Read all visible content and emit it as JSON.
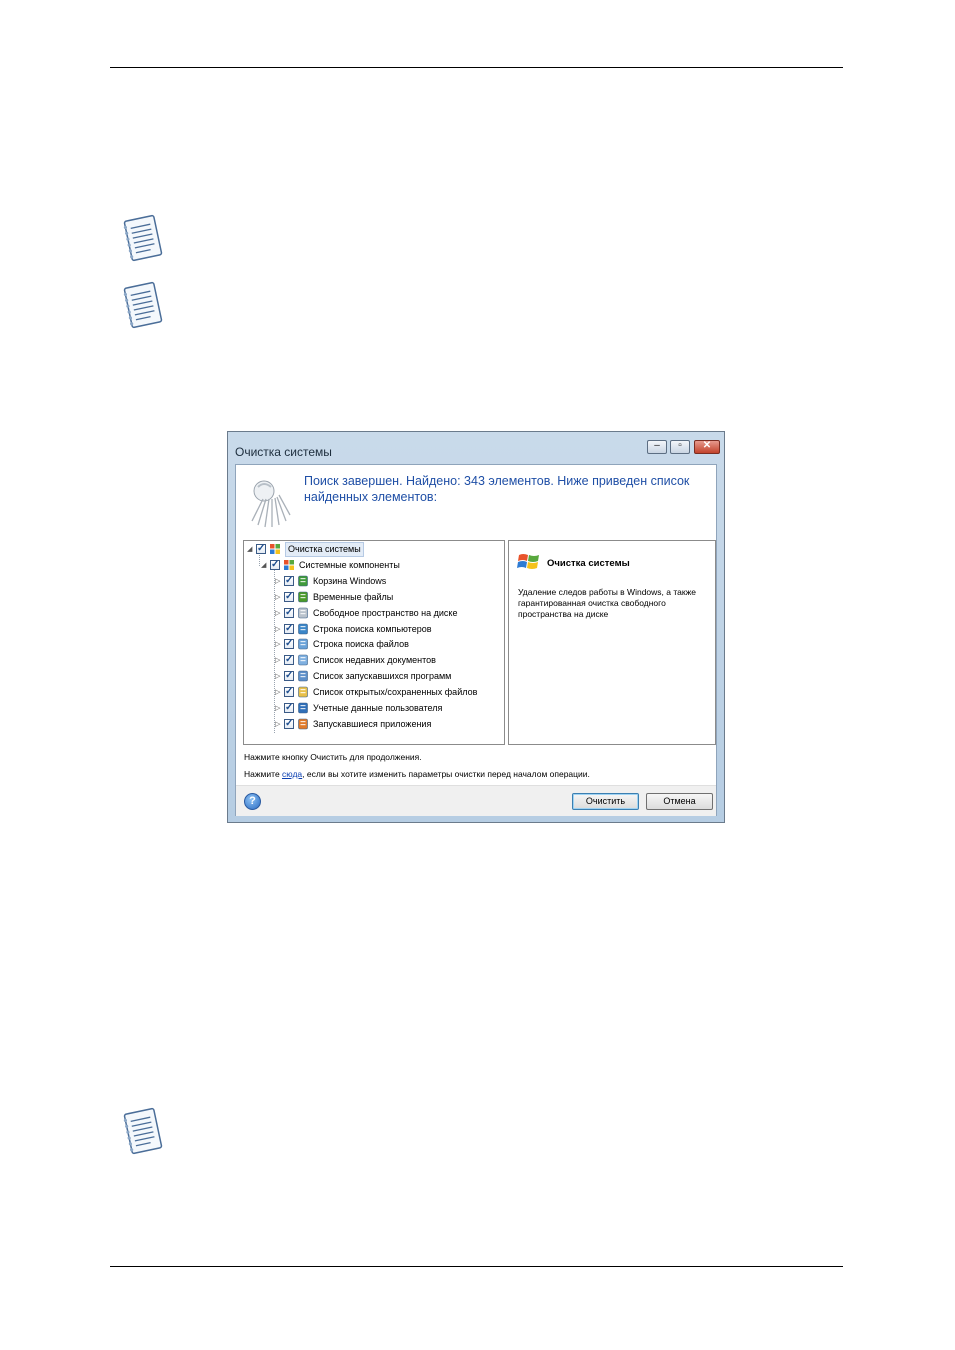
{
  "dialog": {
    "title": "Очистка системы",
    "header_message": "Поиск завершен. Найдено: 343 элементов. Ниже приведен список найденных элементов:",
    "tree": [
      {
        "label": "Очистка системы",
        "level": 0,
        "icon": "windows-flag-icon",
        "selected": true
      },
      {
        "label": "Системные компоненты",
        "level": 1,
        "icon": "windows-flag-icon"
      },
      {
        "label": "Корзина Windows",
        "level": 2,
        "icon": "recycle-bin-icon"
      },
      {
        "label": "Временные файлы",
        "level": 2,
        "icon": "temp-files-icon"
      },
      {
        "label": "Свободное пространство на диске",
        "level": 2,
        "icon": "disk-icon"
      },
      {
        "label": "Строка поиска компьютеров",
        "level": 2,
        "icon": "network-search-icon"
      },
      {
        "label": "Строка поиска файлов",
        "level": 2,
        "icon": "file-search-icon"
      },
      {
        "label": "Список недавних документов",
        "level": 2,
        "icon": "recent-docs-icon"
      },
      {
        "label": "Список запускавшихся программ",
        "level": 2,
        "icon": "run-list-icon"
      },
      {
        "label": "Список открытых/сохраненных файлов",
        "level": 2,
        "icon": "folder-icon"
      },
      {
        "label": "Учетные данные пользователя",
        "level": 2,
        "icon": "user-credentials-icon"
      },
      {
        "label": "Запускавшиеся приложения",
        "level": 2,
        "icon": "applications-icon"
      }
    ],
    "description": {
      "title": "Очистка системы",
      "body": "Удаление следов работы в Windows, а также гарантированная очистка свободного пространства на диске"
    },
    "info_line1": "Нажмите кнопку Очистить для продолжения.",
    "info_line2_prefix": "Нажмите ",
    "info_line2_link": "сюда",
    "info_line2_suffix": ", если вы хотите изменить параметры очистки перед началом операции.",
    "buttons": {
      "ok": "Очистить",
      "cancel": "Отмена"
    },
    "help_glyph": "?"
  },
  "colors": {
    "header_text": "#1f4fa6",
    "link": "#0b3fb1"
  }
}
